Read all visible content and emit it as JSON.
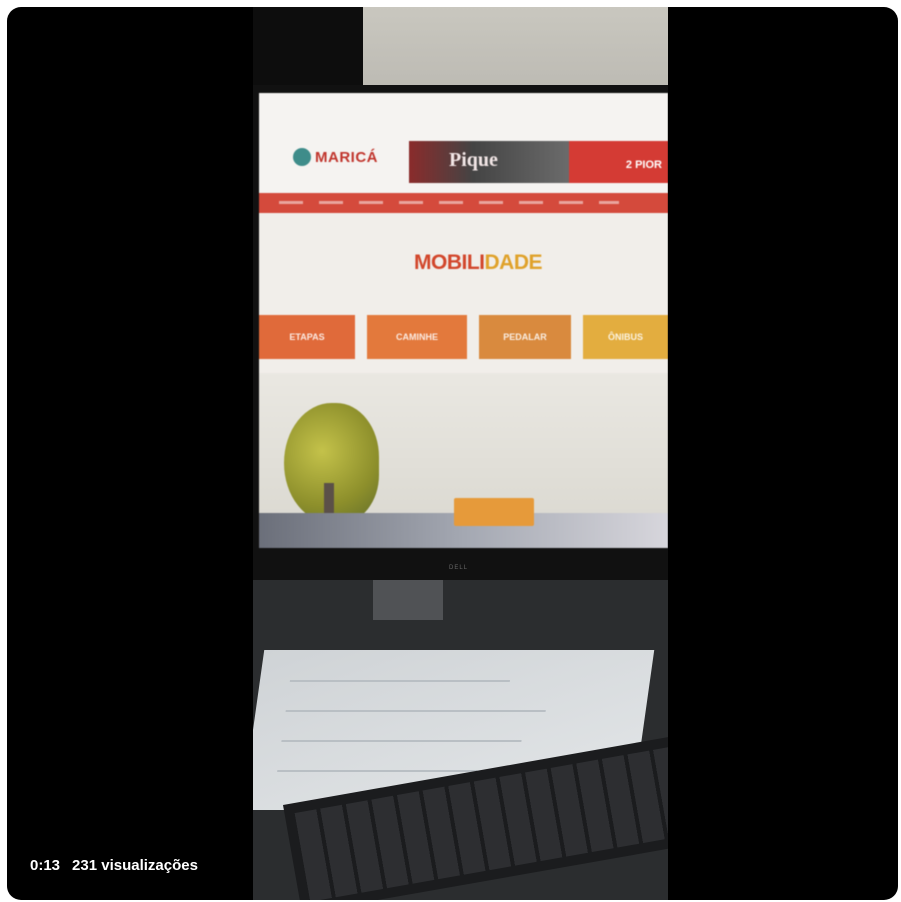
{
  "screen_site": {
    "logo_text": "MARICÁ",
    "banner_text_left": "Pique",
    "banner_text_right": "2 PIOR",
    "feature_logo_part1": "MOBILI",
    "feature_logo_part2": "DADE",
    "tiles": [
      "ETAPAS",
      "CAMINHE",
      "PEDALAR",
      "ÔNIBUS"
    ]
  },
  "monitor_brand": "DELL",
  "player": {
    "time": "0:13",
    "views": "231 visualizações"
  },
  "colors": {
    "nav_red": "#d44a3c",
    "logo_teal": "#3e8c8a"
  }
}
